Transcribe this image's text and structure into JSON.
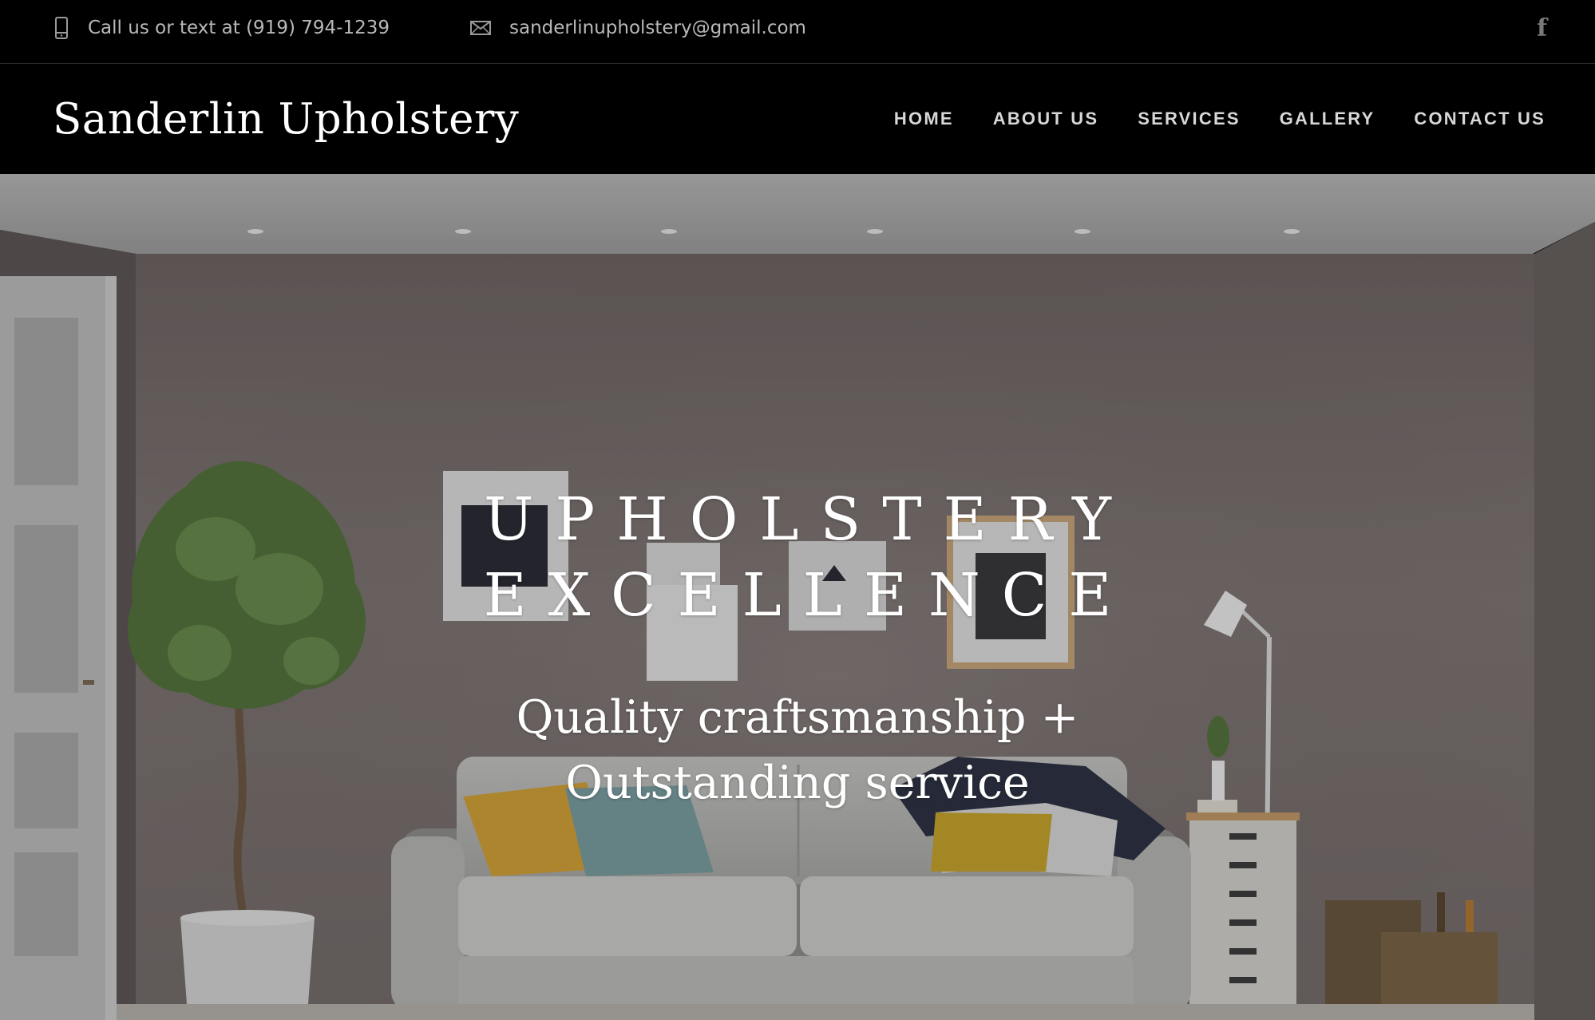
{
  "topbar": {
    "phone_icon": "mobile-phone-icon",
    "phone_text": "Call us or text at (919) 794-1239",
    "email_icon": "envelope-icon",
    "email_text": "sanderlinupholstery@gmail.com",
    "social_icon": "facebook-icon",
    "social_glyph": "f"
  },
  "header": {
    "logo": "Sanderlin Upholstery",
    "nav": [
      "HOME",
      "ABOUT US",
      "SERVICES",
      "GALLERY",
      "CONTACT US"
    ]
  },
  "hero": {
    "headline_line1": "UPHOLSTERY",
    "headline_line2": "EXCELLENCE",
    "subheadline": "Quality craftsmanship + Outstanding service"
  },
  "colors": {
    "background": "#000000",
    "text": "#ffffff",
    "nav_text": "#d7d7d7",
    "topbar_text": "#b9b9b9",
    "wall": "#7d7472"
  }
}
